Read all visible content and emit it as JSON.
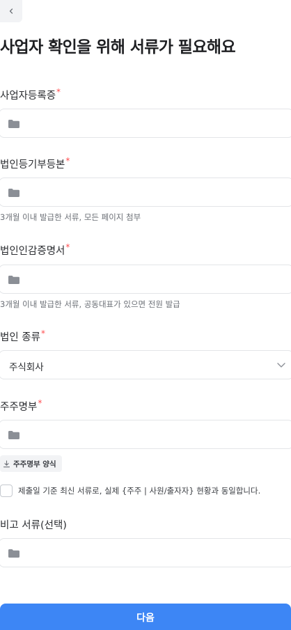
{
  "header": {
    "back_icon": "chevron-left-icon",
    "title": "사업자 확인을 위해 서류가 필요해요"
  },
  "fields": {
    "business_registration": {
      "label": "사업자등록증",
      "required_mark": "*"
    },
    "corporate_registry": {
      "label": "법인등기부등본",
      "required_mark": "*",
      "hint": "3개월 이내 발급한 서류, 모든 페이지 첨부"
    },
    "seal_certificate": {
      "label": "법인인감증명서",
      "required_mark": "*",
      "hint": "3개월 이내 발급한 서류, 공동대표가 있으면 전원 발급"
    },
    "corporation_type": {
      "label": "법인 종류",
      "required_mark": "*",
      "value": "주식회사"
    },
    "shareholder_list": {
      "label": "주주명부",
      "required_mark": "*",
      "download_label": "주주명부 양식"
    },
    "confirm": {
      "text": "제출일 기준 최신 서류로, 실제 {주주 | 사원/출자자} 현황과 동일합니다."
    },
    "remarks": {
      "label": "비고 서류(선택)"
    }
  },
  "footer": {
    "next_label": "다음"
  },
  "colors": {
    "accent": "#3d86f5",
    "required": "#ff4d4f",
    "icon": "#8b8f96",
    "border": "#e3e5e8"
  }
}
